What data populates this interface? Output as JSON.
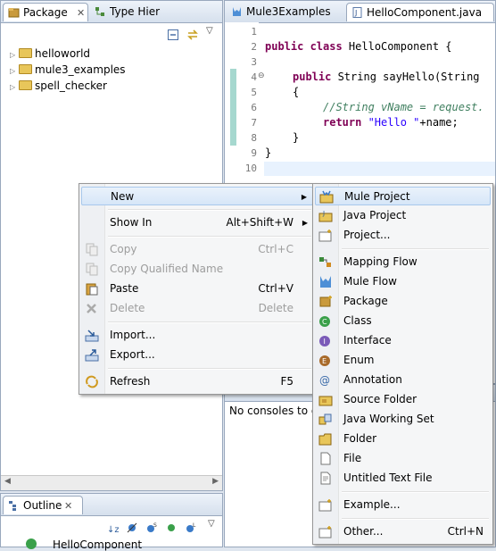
{
  "package_explorer": {
    "tabs": [
      {
        "label": "Package"
      },
      {
        "label": "Type Hier"
      }
    ],
    "tree": [
      {
        "label": "helloworld"
      },
      {
        "label": "mule3_examples"
      },
      {
        "label": "spell_checker"
      }
    ]
  },
  "editor": {
    "tabs": [
      {
        "label": "Mule3Examples"
      },
      {
        "label": "HelloComponent.java"
      }
    ],
    "line_numbers": [
      "1",
      "2",
      "3",
      "4",
      "5",
      "6",
      "7",
      "8",
      "9",
      "10"
    ],
    "code": {
      "l2_kw": "public class",
      "l2_rest": " HelloComponent {",
      "l4_kw": "public",
      "l4_rest": " String sayHello(String",
      "l5": "{",
      "l6_comment": "//String vName = request.",
      "l7_kw": "return",
      "l7_str": " \"Hello \"",
      "l7_rest": "+name;",
      "l8": "}",
      "l9": "}"
    }
  },
  "console": {
    "message": "No consoles to dis"
  },
  "outline": {
    "tab_label": "Outline",
    "item": "HelloComponent"
  },
  "context_menu": {
    "items": [
      {
        "label": "New"
      },
      {
        "label": "Show In",
        "shortcut": "Alt+Shift+W"
      },
      {
        "label": "Copy",
        "shortcut": "Ctrl+C"
      },
      {
        "label": "Copy Qualified Name"
      },
      {
        "label": "Paste",
        "shortcut": "Ctrl+V"
      },
      {
        "label": "Delete",
        "shortcut": "Delete"
      },
      {
        "label": "Import..."
      },
      {
        "label": "Export..."
      },
      {
        "label": "Refresh",
        "shortcut": "F5"
      }
    ]
  },
  "new_submenu": {
    "items": [
      {
        "label": "Mule Project"
      },
      {
        "label": "Java Project"
      },
      {
        "label": "Project..."
      },
      {
        "label": "Mapping Flow"
      },
      {
        "label": "Mule Flow"
      },
      {
        "label": "Package"
      },
      {
        "label": "Class"
      },
      {
        "label": "Interface"
      },
      {
        "label": "Enum"
      },
      {
        "label": "Annotation"
      },
      {
        "label": "Source Folder"
      },
      {
        "label": "Java Working Set"
      },
      {
        "label": "Folder"
      },
      {
        "label": "File"
      },
      {
        "label": "Untitled Text File"
      },
      {
        "label": "Example..."
      },
      {
        "label": "Other...",
        "shortcut": "Ctrl+N"
      }
    ]
  },
  "colors": {
    "keyword": "#7f0055",
    "comment": "#3f7f5f",
    "string": "#2a00ff",
    "highlight": "#d6e6f8"
  }
}
